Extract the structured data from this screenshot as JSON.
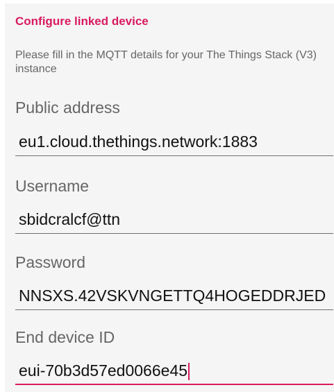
{
  "dialog": {
    "title": "Configure linked device",
    "description": "Please fill in the MQTT details for your The Things Stack (V3) instance"
  },
  "fields": {
    "public_address": {
      "label": "Public address",
      "value": "eu1.cloud.thethings.network:1883"
    },
    "username": {
      "label": "Username",
      "value": "sbidcralcf@ttn"
    },
    "password": {
      "label": "Password",
      "value": "NNSXS.42VSKVNGETTQ4HOGEDDRJED"
    },
    "end_device_id": {
      "label": "End device ID",
      "value": "eui-70b3d57ed0066e45"
    }
  },
  "colors": {
    "accent": "#d81b60",
    "panel_background": "#f5f5f5",
    "label_text": "#666666"
  }
}
